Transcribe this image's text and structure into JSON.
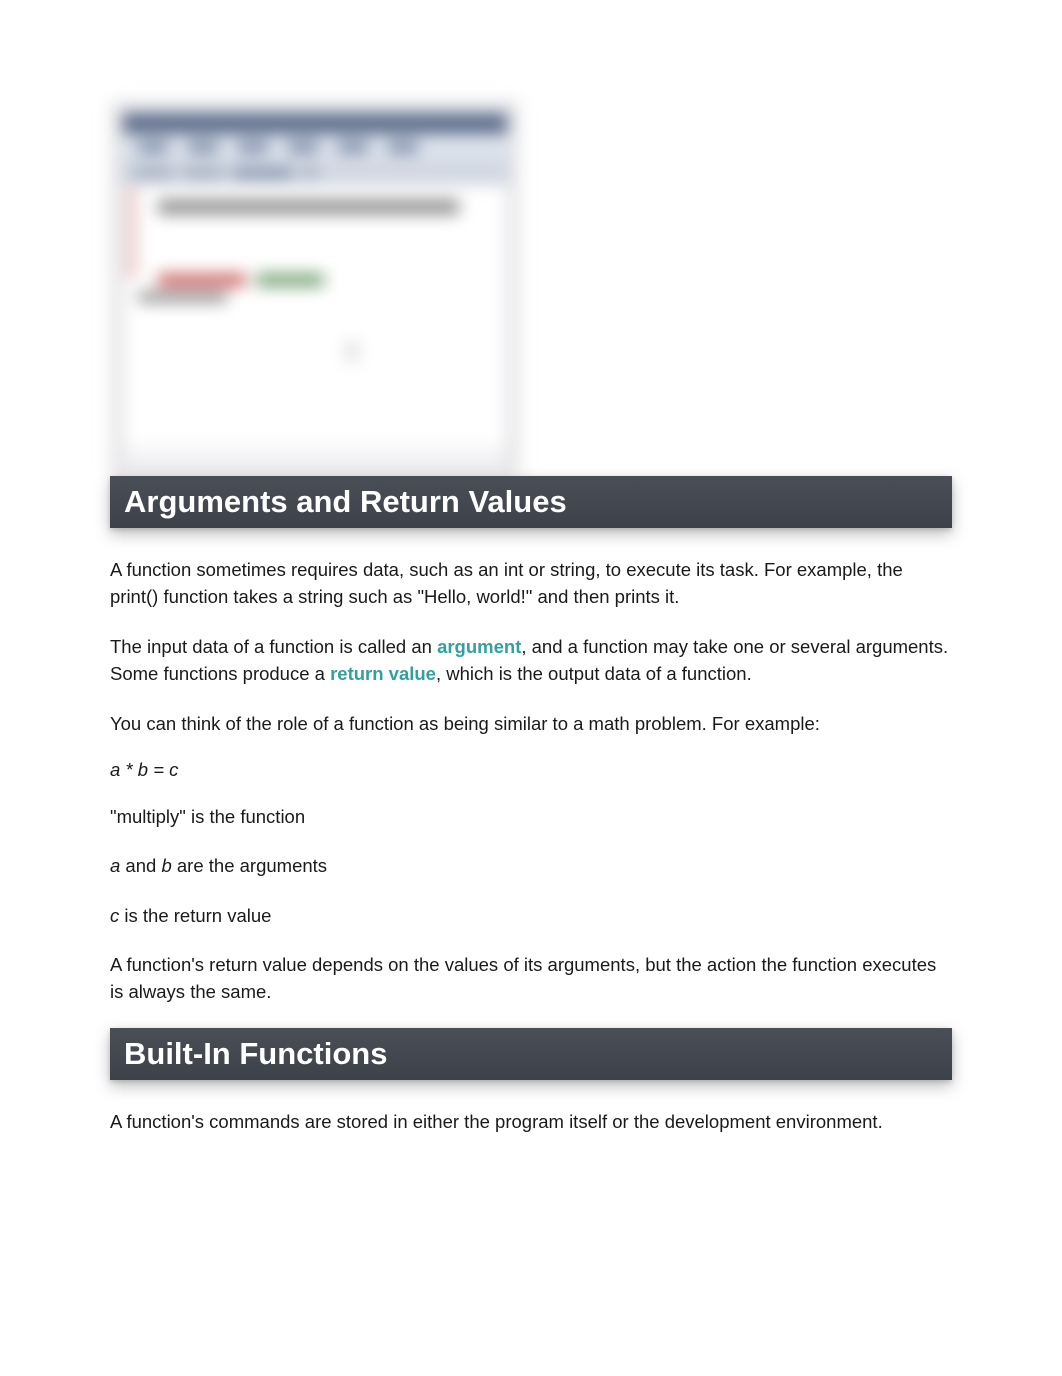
{
  "sections": {
    "arguments": {
      "heading": "Arguments and Return Values",
      "para1": "A function sometimes requires data, such as an int or string, to execute its task. For example, the print() function takes a string such as \"Hello, world!\" and then prints it.",
      "para2_pre": "The input data of a function is called an ",
      "para2_kw1": "argument",
      "para2_mid": ", and a function may take one or several arguments. Some functions produce a ",
      "para2_kw2": "return value",
      "para2_post": ", which is the output data of a function.",
      "para3": "You can think of the role of a function as being similar to a math problem. For example:",
      "formula": "a * b = c",
      "para4": "\"multiply\" is the function",
      "para5_a": "a",
      "para5_mid": " and ",
      "para5_b": "b",
      "para5_post": " are the arguments",
      "para6_c": "c",
      "para6_post": " is the return value",
      "para7": "A function's return value depends on the values of its arguments, but the action the function executes is always the same."
    },
    "builtin": {
      "heading": "Built-In Functions",
      "para1": "A function's commands are stored in either the program itself or the development environment."
    }
  }
}
